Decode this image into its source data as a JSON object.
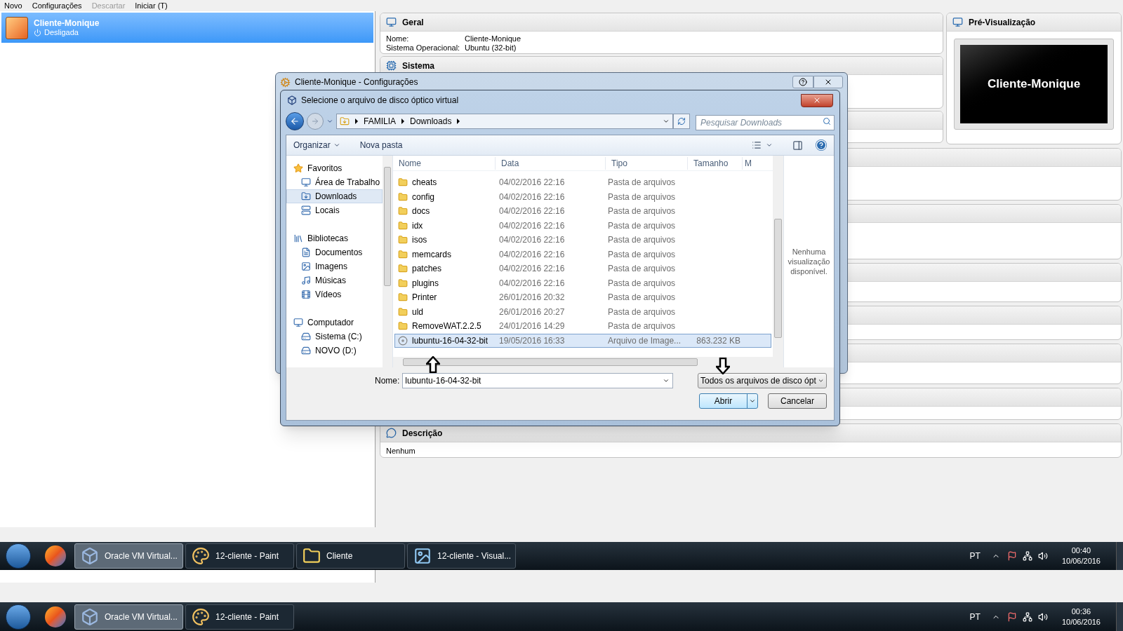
{
  "menu_bar": [
    {
      "label": "Novo",
      "disabled": false
    },
    {
      "label": "Configurações",
      "disabled": false
    },
    {
      "label": "Descartar",
      "disabled": true
    },
    {
      "label": "Iniciar (T)",
      "disabled": false
    }
  ],
  "vm_list": [
    {
      "name": "Cliente-Monique",
      "status": "Desligada",
      "selected": true
    }
  ],
  "details": {
    "general": {
      "title": "Geral",
      "rows": [
        {
          "label": "Nome:",
          "value": "Cliente-Monique"
        },
        {
          "label": "Sistema Operacional:",
          "value": "Ubuntu (32-bit)"
        }
      ]
    },
    "system": {
      "title": "Sistema"
    },
    "preview": {
      "title": "Pré-Visualização",
      "screen_text": "Cliente-Monique"
    },
    "description": {
      "title": "Descrição",
      "text": "Nenhum"
    }
  },
  "settings_dialog": {
    "title": "Cliente-Monique - Configurações"
  },
  "file_dialog": {
    "title": "Selecione o arquivo de disco óptico virtual",
    "breadcrumb": [
      "FAMILIA",
      "Downloads"
    ],
    "search": {
      "placeholder": "Pesquisar Downloads"
    },
    "toolbar": [
      {
        "label": "Organizar",
        "kind": "menu"
      },
      {
        "label": "Nova pasta",
        "kind": "plain"
      }
    ],
    "nav": [
      {
        "label": "Favoritos",
        "kind": "favorites",
        "children": [
          {
            "label": "Área de Trabalho",
            "kind": "desktop",
            "selected": false
          },
          {
            "label": "Downloads",
            "kind": "downloads",
            "selected": true
          },
          {
            "label": "Locais",
            "kind": "places",
            "selected": false
          }
        ]
      },
      {
        "label": "Bibliotecas",
        "kind": "libraries",
        "children": [
          {
            "label": "Documentos",
            "kind": "documents",
            "selected": false
          },
          {
            "label": "Imagens",
            "kind": "images",
            "selected": false
          },
          {
            "label": "Músicas",
            "kind": "music",
            "selected": false
          },
          {
            "label": "Vídeos",
            "kind": "videos",
            "selected": false
          }
        ]
      },
      {
        "label": "Computador",
        "kind": "computer",
        "children": [
          {
            "label": "Sistema (C:)",
            "kind": "system_drive",
            "selected": false
          },
          {
            "label": "NOVO (D:)",
            "kind": "drive",
            "selected": false
          }
        ]
      }
    ],
    "columns": [
      "Nome",
      "Data",
      "Tipo",
      "Tamanho",
      "M"
    ],
    "files": [
      {
        "name": "cheats",
        "date": "04/02/2016 22:16",
        "type": "Pasta de arquivos",
        "kind": "folder",
        "selected": false
      },
      {
        "name": "config",
        "date": "04/02/2016 22:16",
        "type": "Pasta de arquivos",
        "kind": "folder",
        "selected": false
      },
      {
        "name": "docs",
        "date": "04/02/2016 22:16",
        "type": "Pasta de arquivos",
        "kind": "folder",
        "selected": false
      },
      {
        "name": "idx",
        "date": "04/02/2016 22:16",
        "type": "Pasta de arquivos",
        "kind": "folder",
        "selected": false
      },
      {
        "name": "isos",
        "date": "04/02/2016 22:16",
        "type": "Pasta de arquivos",
        "kind": "folder",
        "selected": false
      },
      {
        "name": "memcards",
        "date": "04/02/2016 22:16",
        "type": "Pasta de arquivos",
        "kind": "folder",
        "selected": false
      },
      {
        "name": "patches",
        "date": "04/02/2016 22:16",
        "type": "Pasta de arquivos",
        "kind": "folder",
        "selected": false
      },
      {
        "name": "plugins",
        "date": "04/02/2016 22:16",
        "type": "Pasta de arquivos",
        "kind": "folder",
        "selected": false
      },
      {
        "name": "Printer",
        "date": "26/01/2016 20:32",
        "type": "Pasta de arquivos",
        "kind": "folder",
        "selected": false
      },
      {
        "name": "uld",
        "date": "26/01/2016 20:27",
        "type": "Pasta de arquivos",
        "kind": "folder",
        "selected": false
      },
      {
        "name": "RemoveWAT.2.2.5",
        "date": "24/01/2016 14:29",
        "type": "Pasta de arquivos",
        "kind": "folder",
        "selected": false
      },
      {
        "name": "lubuntu-16-04-32-bit",
        "date": "19/05/2016 16:33",
        "type": "Arquivo de Image...",
        "size": "863.232 KB",
        "kind": "disc_image",
        "selected": true
      }
    ],
    "preview_message": "Nenhuma visualização disponível.",
    "filename": {
      "label": "Nome:",
      "value": "lubuntu-16-04-32-bit"
    },
    "filter": "Todos os arquivos de disco ópt",
    "buttons": [
      {
        "label": "Abrir",
        "kind": "split",
        "default": true
      },
      {
        "label": "Cancelar",
        "kind": "plain",
        "default": false
      }
    ]
  },
  "taskbars": [
    {
      "buttons": [
        {
          "label": "Oracle VM Virtual...",
          "kind": "virtualbox",
          "active": true
        },
        {
          "label": "12-cliente - Paint",
          "kind": "paint",
          "active": false
        },
        {
          "label": "Cliente",
          "kind": "folder",
          "active": false
        },
        {
          "label": "12-cliente - Visual...",
          "kind": "viewer",
          "active": false
        }
      ],
      "tray": {
        "language": "PT",
        "time": "00:40",
        "date": "10/06/2016"
      }
    },
    {
      "buttons": [
        {
          "label": "Oracle VM Virtual...",
          "kind": "virtualbox",
          "active": true
        },
        {
          "label": "12-cliente - Paint",
          "kind": "paint",
          "active": false
        }
      ],
      "tray": {
        "language": "PT",
        "time": "00:36",
        "date": "10/06/2016"
      }
    }
  ]
}
